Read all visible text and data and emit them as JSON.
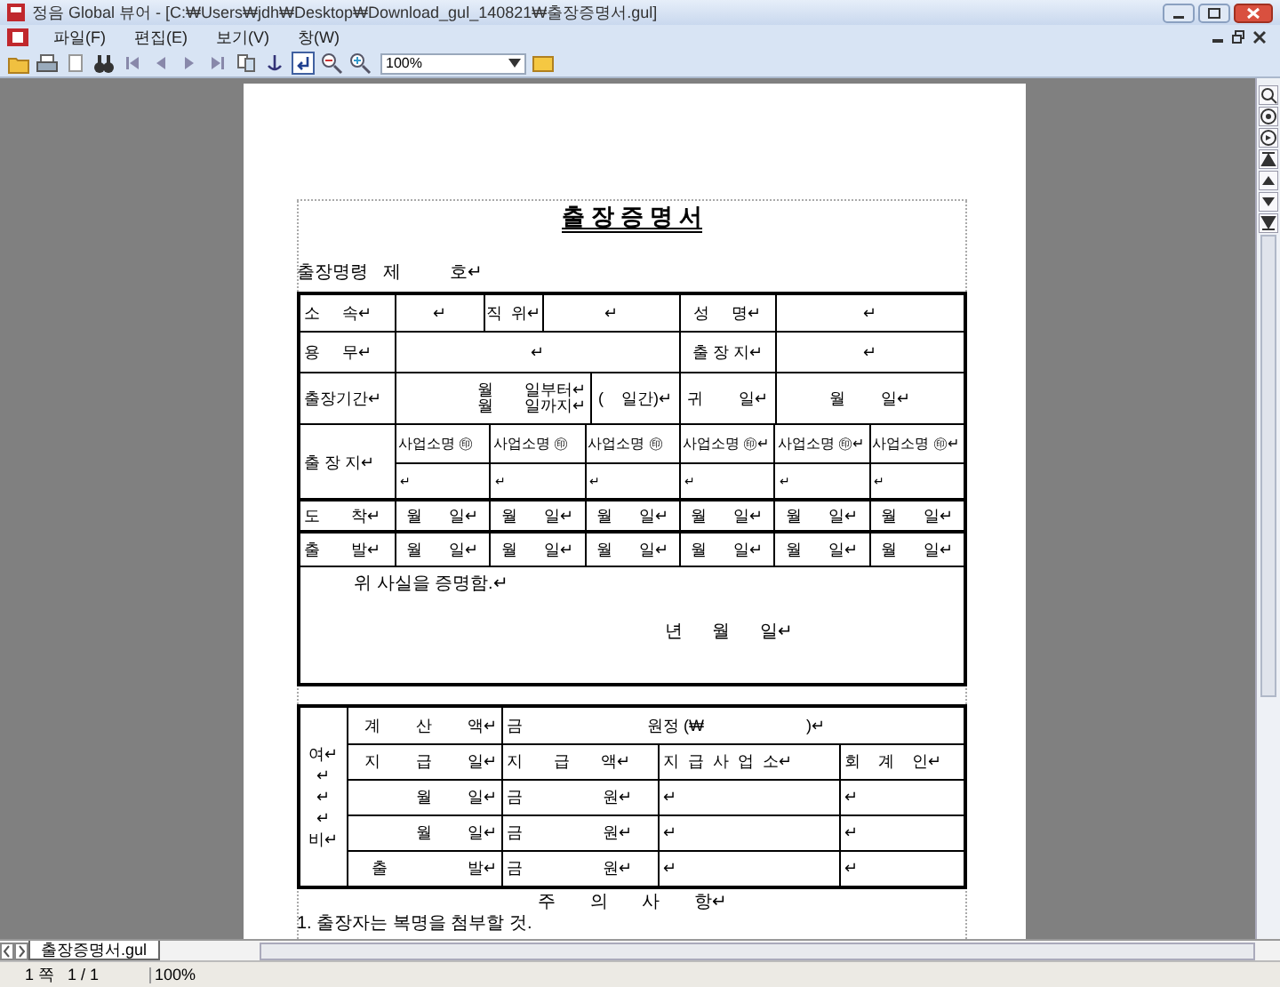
{
  "window": {
    "title": "정음 Global 뷰어 - [C:₩Users₩jdh₩Desktop₩Download_gul_140821₩출장증명서.gul]"
  },
  "menu": [
    "파일(F)",
    "편집(E)",
    "보기(V)",
    "창(W)"
  ],
  "toolbar": {
    "zoom": "100%"
  },
  "document": {
    "title": "출 장 증 명 서",
    "order_line": "출장명령   제          호↵",
    "table": [
      {
        "kind": "fields",
        "cells": [
          "소     속↵",
          "↵",
          "직  위↵",
          "↵",
          "성     명↵",
          "↵"
        ]
      },
      {
        "kind": "fields",
        "cells": [
          "용     무↵",
          "↵",
          "출 장 지↵",
          "↵"
        ]
      },
      {
        "kind": "period",
        "cells": [
          "출장기간↵",
          "월       일부터↵\n월       일까지↵",
          "(    일간)↵",
          "귀        일↵",
          "월        일↵"
        ]
      },
      {
        "kind": "destination",
        "label": "출 장 지↵",
        "seals": [
          "사업소명 ㊞",
          "사업소명 ㊞",
          "사업소명 ㊞",
          "사업소명 ㊞↵",
          "사업소명 ㊞↵",
          "사업소명 ㊞↵"
        ],
        "blanks": [
          "↵",
          "↵",
          "↵",
          "↵",
          "↵",
          "↵"
        ]
      },
      {
        "kind": "dates",
        "cells": [
          "도       착↵",
          "월      일↵",
          "월      일↵",
          "월      일↵",
          "월      일↵",
          "월      일↵",
          "월      일↵"
        ]
      },
      {
        "kind": "dates",
        "cells": [
          "출       발↵",
          "월      일↵",
          "월      일↵",
          "월      일↵",
          "월      일↵",
          "월      일↵",
          "월      일↵"
        ]
      },
      {
        "kind": "statement",
        "text": "위 사실을 증명함.↵",
        "date": "년      월      일↵"
      }
    ],
    "expense": {
      "label_lines": [
        "여↵",
        "↵",
        "↵",
        "↵",
        "비↵"
      ],
      "rows": [
        {
          "cells": [
            "계        산        액↵",
            "금                            원정 (₩                       )↵"
          ]
        },
        {
          "cells": [
            "지        급        일↵",
            "지       급       액↵",
            "지  급  사  업  소↵",
            "회    계    인↵"
          ]
        },
        {
          "cells": [
            "월        일↵",
            "금                  원↵",
            "↵",
            "↵"
          ]
        },
        {
          "cells": [
            "월        일↵",
            "금                  원↵",
            "↵",
            "↵"
          ]
        },
        {
          "cells": [
            "출                  발↵",
            "금                  원↵",
            "↵",
            "↵"
          ]
        }
      ]
    },
    "notes_title": "주       의       사       항↵",
    "notes": [
      "1. 출장자는 복명을 첨부할 것."
    ]
  },
  "tab": {
    "label": "출장증명서.gul"
  },
  "status_bar": [
    "1 쪽",
    "1 / 1",
    "100%"
  ]
}
